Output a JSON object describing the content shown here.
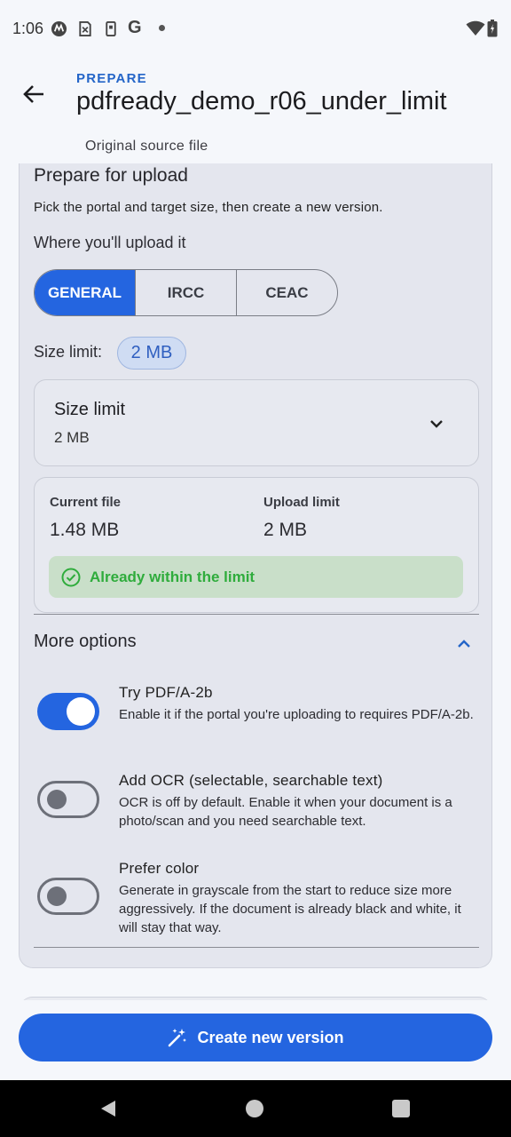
{
  "status_bar": {
    "time": "1:06",
    "icons": [
      "motorola-icon",
      "sim-icon",
      "battery-saver-icon",
      "google-icon",
      "dot-icon",
      "wifi-icon",
      "battery-icon"
    ],
    "google_glyph": "G"
  },
  "app_bar": {
    "overline": "PREPARE",
    "title": "pdfready_demo_r06_under_limit",
    "subtitle": "Original source file",
    "back_icon": "arrow-back-icon"
  },
  "prepare": {
    "title": "Prepare for upload",
    "description": "Pick the portal and target size, then create a new version.",
    "upload_label": "Where you'll upload it",
    "portals": [
      {
        "label": "GENERAL",
        "selected": true
      },
      {
        "label": "IRCC",
        "selected": false
      },
      {
        "label": "CEAC",
        "selected": false
      }
    ],
    "size_limit_label": "Size limit:",
    "size_limit_chip": "2 MB",
    "dropdown": {
      "label": "Size limit",
      "value": "2 MB",
      "icon": "chevron-down-icon"
    },
    "info": {
      "current_label": "Current file",
      "current_value": "1.48 MB",
      "limit_label": "Upload limit",
      "limit_value": "2 MB",
      "status_text": "Already within the limit",
      "status_icon": "check-circle-icon",
      "status_color": "#2fac3c"
    }
  },
  "more_options": {
    "title": "More options",
    "icon": "chevron-up-icon",
    "items": [
      {
        "title": "Try PDF/A-2b",
        "description": "Enable it if the portal you're uploading to requires PDF/A-2b.",
        "enabled": true
      },
      {
        "title": "Add OCR (selectable, searchable text)",
        "description": "OCR is off by default. Enable it when your document is a photo/scan and you need searchable text.",
        "enabled": false
      },
      {
        "title": "Prefer color",
        "description": "Generate in grayscale from the start to reduce size more aggressively. If the document is already black and white, it will stay that way.",
        "enabled": false
      }
    ]
  },
  "actions": {
    "create_label": "Create new version",
    "create_icon": "magic-wand-icon"
  },
  "colors": {
    "accent": "#2465e0",
    "overline": "#2465c8",
    "success_bg": "#c9dfc9"
  }
}
